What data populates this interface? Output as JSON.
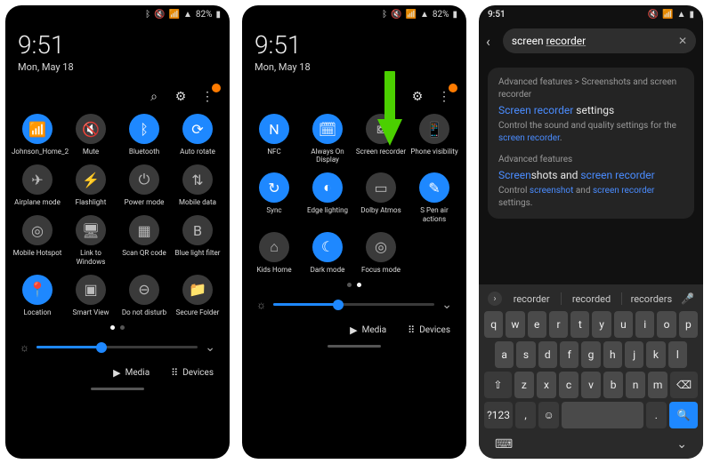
{
  "status": {
    "time": "9:51",
    "battery_pct": "82%",
    "icons": [
      "bt",
      "mute",
      "wifi",
      "signal",
      "battery"
    ]
  },
  "clock": {
    "time": "9:51",
    "date": "Mon, May 18"
  },
  "panel_icons": {
    "search": "search-icon",
    "settings": "gear-icon",
    "more": "more-icon"
  },
  "quick1": [
    {
      "label": "Johnson_Home_2",
      "icon": "wifi",
      "on": true
    },
    {
      "label": "Mute",
      "icon": "mute",
      "on": false
    },
    {
      "label": "Bluetooth",
      "icon": "bt",
      "on": true
    },
    {
      "label": "Auto rotate",
      "icon": "rotate",
      "on": true
    },
    {
      "label": "Airplane mode",
      "icon": "plane",
      "on": false
    },
    {
      "label": "Flashlight",
      "icon": "flash",
      "on": false
    },
    {
      "label": "Power mode",
      "icon": "power",
      "on": false
    },
    {
      "label": "Mobile data",
      "icon": "data",
      "on": false
    },
    {
      "label": "Mobile Hotspot",
      "icon": "hotspot",
      "on": false
    },
    {
      "label": "Link to Windows",
      "icon": "link",
      "on": false
    },
    {
      "label": "Scan QR code",
      "icon": "qr",
      "on": false
    },
    {
      "label": "Blue light filter",
      "icon": "bluelight",
      "on": false
    },
    {
      "label": "Location",
      "icon": "loc",
      "on": true
    },
    {
      "label": "Smart View",
      "icon": "cast",
      "on": false
    },
    {
      "label": "Do not disturb",
      "icon": "dnd",
      "on": false
    },
    {
      "label": "Secure Folder",
      "icon": "folder",
      "on": false
    }
  ],
  "quick2": [
    {
      "label": "NFC",
      "icon": "nfc",
      "on": true
    },
    {
      "label": "Always On Display",
      "icon": "aod",
      "on": true
    },
    {
      "label": "Screen recorder",
      "icon": "rec",
      "on": false
    },
    {
      "label": "Phone visibility",
      "icon": "vis",
      "on": false
    },
    {
      "label": "Sync",
      "icon": "sync",
      "on": true
    },
    {
      "label": "Edge lighting",
      "icon": "edge",
      "on": true
    },
    {
      "label": "Dolby Atmos",
      "icon": "dolby",
      "on": false
    },
    {
      "label": "S Pen air actions",
      "icon": "spen",
      "on": true
    },
    {
      "label": "Kids Home",
      "icon": "kids",
      "on": false
    },
    {
      "label": "Dark mode",
      "icon": "dark",
      "on": true
    },
    {
      "label": "Focus mode",
      "icon": "focus",
      "on": false
    }
  ],
  "brightness_pct": 40,
  "bottom": {
    "media": "Media",
    "devices": "Devices"
  },
  "search": {
    "query_plain": "screen ",
    "query_ul": "recorder",
    "back": "back-icon",
    "clear": "close-icon"
  },
  "results": [
    {
      "crumb": "Advanced features > Screenshots and screen recorder",
      "title_hl": "Screen recorder",
      "title_rest": " settings",
      "desc_pre": "Control the sound and quality settings for the ",
      "desc_hl": "screen recorder",
      "desc_post": "."
    },
    {
      "crumb": "Advanced features",
      "title_a": "Screen",
      "title_b": "shots and ",
      "title_c": "screen recorder",
      "desc_pre": "Control ",
      "desc_hl1": "screenshot",
      "desc_mid": " and ",
      "desc_hl2": "screen recorder",
      "desc_post": " settings."
    }
  ],
  "suggest": {
    "chip": "›",
    "w1": "recorder",
    "w2": "recorded",
    "w3": "recorders"
  },
  "kb": {
    "r1": [
      "q",
      "w",
      "e",
      "r",
      "t",
      "y",
      "u",
      "i",
      "o",
      "p"
    ],
    "r2": [
      "a",
      "s",
      "d",
      "f",
      "g",
      "h",
      "j",
      "k",
      "l"
    ],
    "r3": [
      "⇧",
      "z",
      "x",
      "c",
      "v",
      "b",
      "n",
      "m",
      "⌫"
    ],
    "sym": "?123",
    "emoji": "☺",
    "comma": ",",
    "period": ".",
    "search": "🔍"
  },
  "colors": {
    "accent": "#1e88ff",
    "arrow": "#4bd000"
  }
}
